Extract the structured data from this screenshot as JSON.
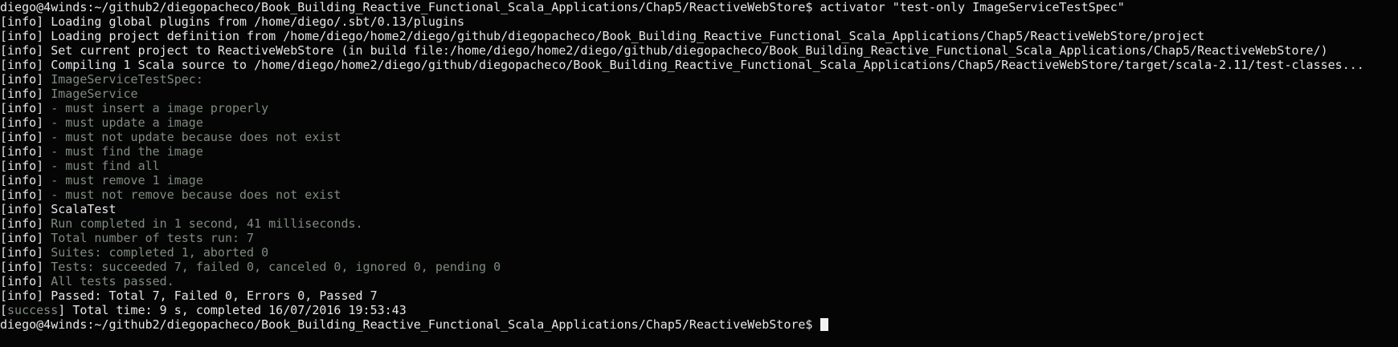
{
  "terminal": {
    "colors": {
      "background": "#050505",
      "text": "#e6e6e6",
      "muted": "#7f8a7f",
      "cursor": "#f2f2f2"
    },
    "lines": [
      {
        "prefix": "",
        "text": "diego@4winds:~/github2/diegopacheco/Book_Building_Reactive_Functional_Scala_Applications/Chap5/ReactiveWebStore$ activator \"test-only ImageServiceTestSpec\"",
        "tone": "white"
      },
      {
        "prefix": "[info] ",
        "text": "Loading global plugins from /home/diego/.sbt/0.13/plugins",
        "tone": "white"
      },
      {
        "prefix": "[info] ",
        "text": "Loading project definition from /home/diego/home2/diego/github/diegopacheco/Book_Building_Reactive_Functional_Scala_Applications/Chap5/ReactiveWebStore/project",
        "tone": "white"
      },
      {
        "prefix": "[info] ",
        "text": "Set current project to ReactiveWebStore (in build file:/home/diego/home2/diego/github/diegopacheco/Book_Building_Reactive_Functional_Scala_Applications/Chap5/ReactiveWebStore/)",
        "tone": "white"
      },
      {
        "prefix": "[info] ",
        "text": "Compiling 1 Scala source to /home/diego/home2/diego/github/diegopacheco/Book_Building_Reactive_Functional_Scala_Applications/Chap5/ReactiveWebStore/target/scala-2.11/test-classes...",
        "tone": "white"
      },
      {
        "prefix": "[info] ",
        "text": "ImageServiceTestSpec:",
        "tone": "muted"
      },
      {
        "prefix": "[info] ",
        "text": "ImageService",
        "tone": "muted"
      },
      {
        "prefix": "[info] ",
        "text": "- must insert a image properly",
        "tone": "muted"
      },
      {
        "prefix": "[info] ",
        "text": "- must update a image",
        "tone": "muted"
      },
      {
        "prefix": "[info] ",
        "text": "- must not update because does not exist",
        "tone": "muted"
      },
      {
        "prefix": "[info] ",
        "text": "- must find the image",
        "tone": "muted"
      },
      {
        "prefix": "[info] ",
        "text": "- must find all",
        "tone": "muted"
      },
      {
        "prefix": "[info] ",
        "text": "- must remove 1 image",
        "tone": "muted"
      },
      {
        "prefix": "[info] ",
        "text": "- must not remove because does not exist",
        "tone": "muted"
      },
      {
        "prefix": "[info] ",
        "text": "ScalaTest",
        "tone": "white"
      },
      {
        "prefix": "[info] ",
        "text": "Run completed in 1 second, 41 milliseconds.",
        "tone": "muted"
      },
      {
        "prefix": "[info] ",
        "text": "Total number of tests run: 7",
        "tone": "muted"
      },
      {
        "prefix": "[info] ",
        "text": "Suites: completed 1, aborted 0",
        "tone": "muted"
      },
      {
        "prefix": "[info] ",
        "text": "Tests: succeeded 7, failed 0, canceled 0, ignored 0, pending 0",
        "tone": "muted"
      },
      {
        "prefix": "[info] ",
        "text": "All tests passed.",
        "tone": "muted"
      },
      {
        "prefix": "[info] ",
        "text": "Passed: Total 7, Failed 0, Errors 0, Passed 7",
        "tone": "white"
      },
      {
        "prefix": "[",
        "prefix_word": "success",
        "prefix_end": "] ",
        "text": "Total time: 9 s, completed 16/07/2016 19:53:43",
        "tone": "white"
      },
      {
        "prefix": "",
        "text": "diego@4winds:~/github2/diegopacheco/Book_Building_Reactive_Functional_Scala_Applications/Chap5/ReactiveWebStore$ ",
        "tone": "white",
        "cursor": true
      }
    ]
  }
}
